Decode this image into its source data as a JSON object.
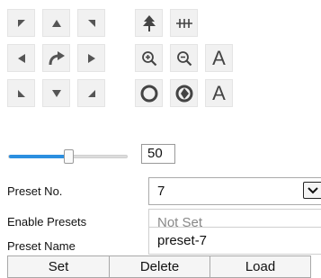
{
  "ptz": {
    "pan_tilt_buttons": [
      {
        "name": "pan-up-left-button",
        "icon": "arrow-up-left-icon"
      },
      {
        "name": "tilt-up-button",
        "icon": "arrow-up-icon"
      },
      {
        "name": "pan-up-right-button",
        "icon": "arrow-up-right-icon"
      },
      {
        "name": "pan-left-button",
        "icon": "arrow-left-icon"
      },
      {
        "name": "auto-scan-button",
        "icon": "auto-rotate-icon"
      },
      {
        "name": "pan-right-button",
        "icon": "arrow-right-icon"
      },
      {
        "name": "pan-down-left-button",
        "icon": "arrow-down-left-icon"
      },
      {
        "name": "tilt-down-button",
        "icon": "arrow-down-icon"
      },
      {
        "name": "pan-down-right-button",
        "icon": "arrow-down-right-icon"
      }
    ],
    "lens_buttons": [
      {
        "name": "light-button",
        "icon": "tree-light-icon"
      },
      {
        "name": "wiper-button",
        "icon": "wiper-icon"
      },
      {
        "name": "zoom-in-button",
        "icon": "zoom-in-icon"
      },
      {
        "name": "zoom-out-button",
        "icon": "zoom-out-icon"
      },
      {
        "name": "focus-near-button",
        "icon": "letter-a-icon",
        "text": "A"
      },
      {
        "name": "iris-open-button",
        "icon": "iris-open-icon"
      },
      {
        "name": "iris-close-button",
        "icon": "iris-close-icon"
      },
      {
        "name": "focus-far-button",
        "icon": "letter-a-icon",
        "text": "A"
      }
    ],
    "speed": {
      "value": "50",
      "level_fraction": 0.5
    },
    "accent_color": "#2b8fe0"
  },
  "preset": {
    "number": {
      "label": "Preset No.",
      "value": "7"
    },
    "enable": {
      "label": "Enable Presets",
      "value": "Not Set"
    },
    "name": {
      "label": "Preset Name",
      "value": "preset-7"
    },
    "actions": {
      "set": "Set",
      "delete": "Delete",
      "load": "Load"
    }
  }
}
